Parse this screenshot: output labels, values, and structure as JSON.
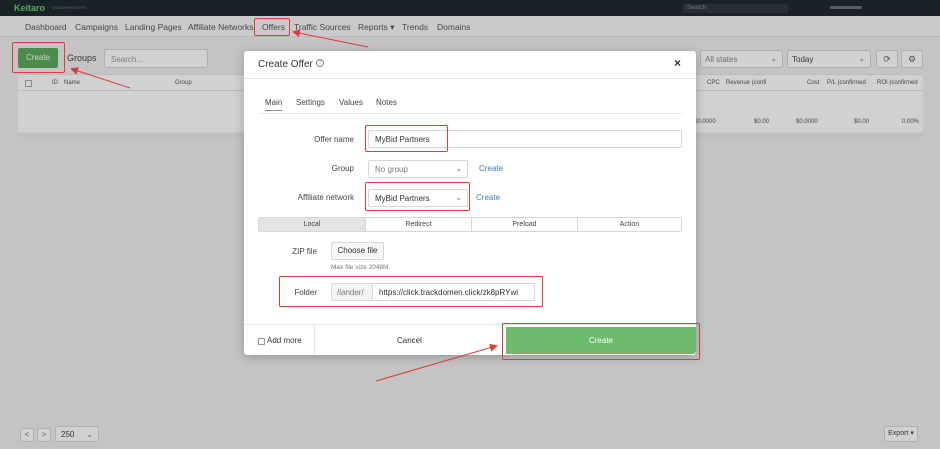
{
  "topbar": {
    "logo": "Keitaro",
    "logo_sub": "MYBIDPARTNERS",
    "search_placeholder": "Search"
  },
  "nav": {
    "items": [
      "Dashboard",
      "Campaigns",
      "Landing Pages",
      "Affiliate Networks",
      "Offers",
      "Traffic Sources",
      "Reports ▾",
      "Trends",
      "Domains"
    ]
  },
  "toolbar": {
    "create_label": "Create",
    "groups_label": "Groups",
    "search_placeholder": "Search...",
    "states_value": "All states",
    "date_value": "Today"
  },
  "table": {
    "headers": [
      "ID",
      "Name",
      "Group",
      "CPC",
      "Revenue (confi",
      "Cost",
      "P/L (confirmed",
      "ROI (confirmed"
    ],
    "totals": [
      "$0.0000",
      "$0.00",
      "$0.0000",
      "$0.00",
      "0.00%"
    ]
  },
  "pagination": {
    "prev": "<",
    "next": ">",
    "per_page": "250",
    "export_label": "Export ▾"
  },
  "modal": {
    "title": "Create Offer",
    "close": "×",
    "tabs": [
      "Main",
      "Settings",
      "Values",
      "Notes"
    ],
    "offer_name_label": "Offer name",
    "offer_name_value": "MyBid Partners",
    "group_label": "Group",
    "group_value": "No group",
    "group_create": "Create",
    "affiliate_label": "Affiliate network",
    "affiliate_value": "MyBid Partners",
    "affiliate_create": "Create",
    "types": [
      "Local",
      "Redirect",
      "Preload",
      "Action"
    ],
    "zip_label": "ZIP file",
    "choose_file": "Choose file",
    "max_size": "Max file size 2048M.",
    "folder_label": "Folder",
    "folder_prefix": "/lander/",
    "folder_value": "https://click.trackdomen.click/zk8pRYwi",
    "add_more": "Add more",
    "cancel": "Cancel",
    "create": "Create"
  },
  "colors": {
    "accent_green": "#5cab5c",
    "annotation_red": "#e03a3a",
    "link_blue": "#3a7bc8"
  }
}
